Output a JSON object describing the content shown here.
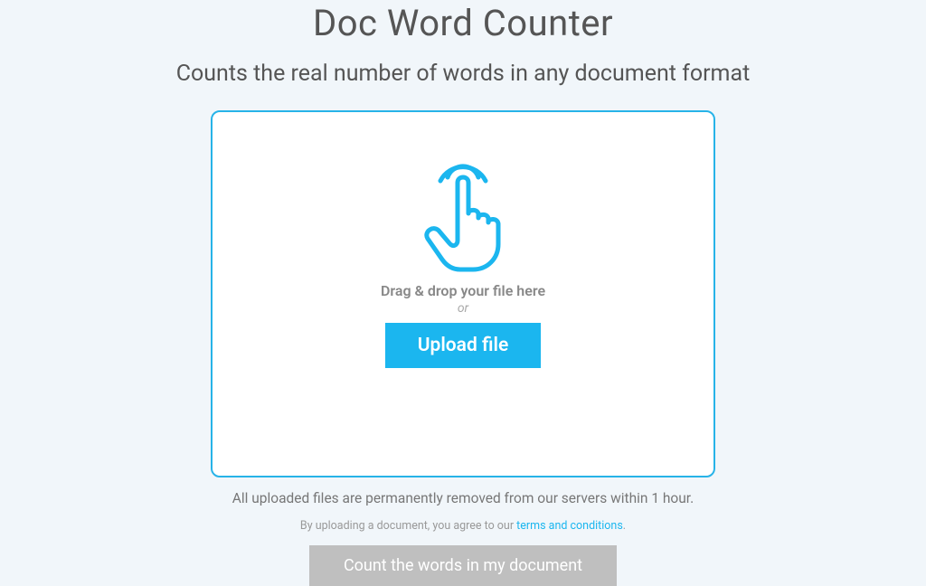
{
  "header": {
    "title": "Doc Word Counter",
    "subtitle": "Counts the real number of words in any document format"
  },
  "dropzone": {
    "drag_text": "Drag & drop your file here",
    "or_text": "or",
    "upload_label": "Upload file"
  },
  "notices": {
    "removal": "All uploaded files are permanently removed from our servers within 1 hour.",
    "agreement_prefix": "By uploading a document, you agree to our ",
    "terms_link": "terms and conditions",
    "agreement_suffix": "."
  },
  "actions": {
    "count_label": "Count the words in my document"
  },
  "colors": {
    "accent": "#1bb6ef",
    "border": "#27b3e8",
    "page_bg": "#f1f6fa",
    "disabled": "#bfbfbf"
  }
}
